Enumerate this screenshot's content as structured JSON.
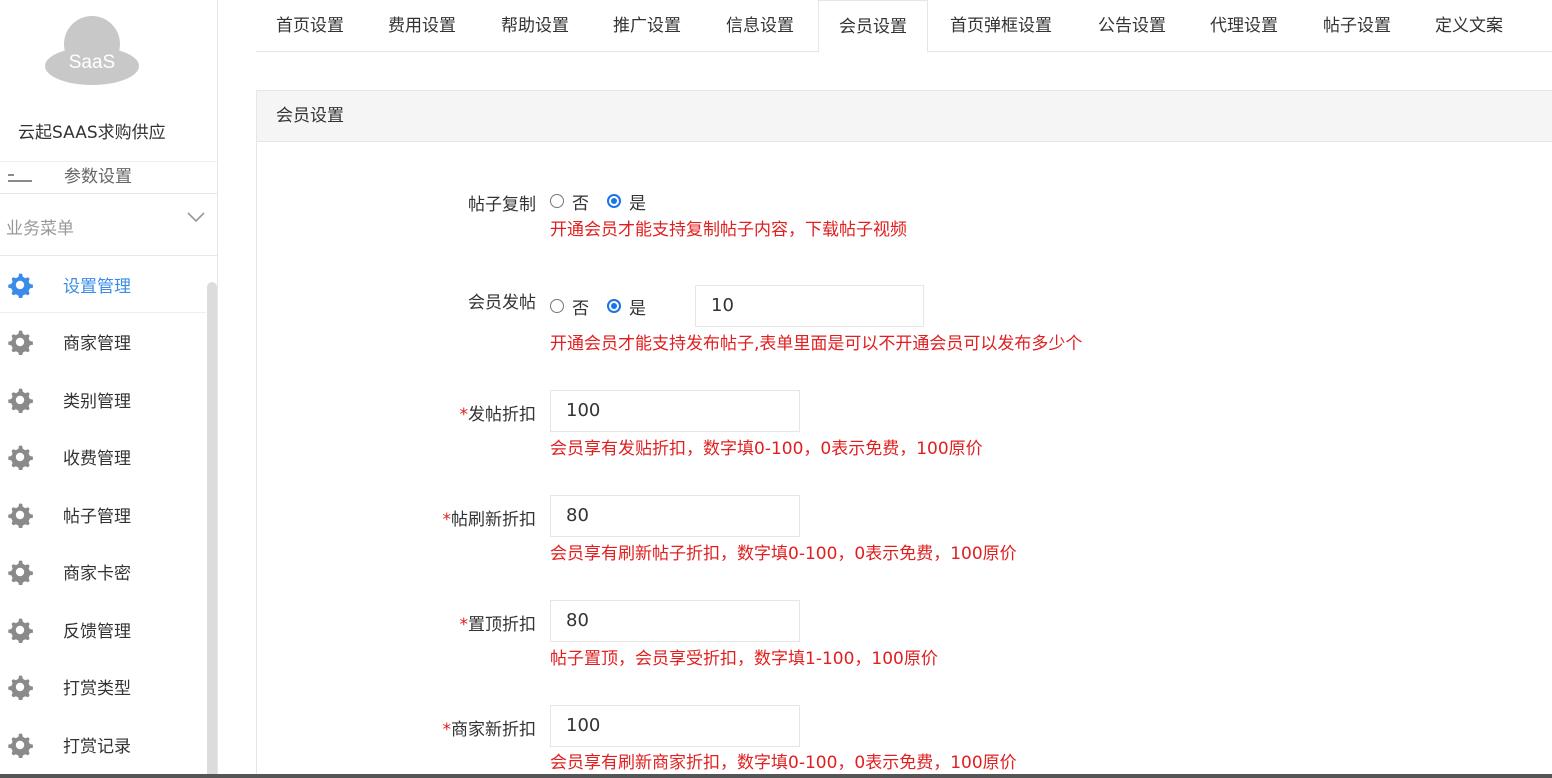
{
  "brand": {
    "logo_text": "SaaS",
    "name": "云起SAAS求购供应"
  },
  "sidebar": {
    "partial_item": "参数设置",
    "group_title": "业务菜单",
    "items": [
      {
        "label": "设置管理",
        "active": true
      },
      {
        "label": "商家管理"
      },
      {
        "label": "类别管理"
      },
      {
        "label": "收费管理"
      },
      {
        "label": "帖子管理"
      },
      {
        "label": "商家卡密"
      },
      {
        "label": "反馈管理"
      },
      {
        "label": "打赏类型"
      },
      {
        "label": "打赏记录"
      }
    ]
  },
  "tabs": [
    {
      "label": "首页设置"
    },
    {
      "label": "费用设置"
    },
    {
      "label": "帮助设置"
    },
    {
      "label": "推广设置"
    },
    {
      "label": "信息设置"
    },
    {
      "label": "会员设置",
      "active": true
    },
    {
      "label": "首页弹框设置"
    },
    {
      "label": "公告设置"
    },
    {
      "label": "代理设置"
    },
    {
      "label": "帖子设置"
    },
    {
      "label": "定义文案"
    }
  ],
  "panel": {
    "title": "会员设置"
  },
  "form": {
    "post_copy": {
      "label": "帖子复制",
      "options": [
        "否",
        "是"
      ],
      "selected": "是",
      "hint": "开通会员才能支持复制帖子内容，下载帖子视频"
    },
    "member_post": {
      "label": "会员发帖",
      "options": [
        "否",
        "是"
      ],
      "selected": "是",
      "value": "10",
      "hint": "开通会员才能支持发布帖子,表单里面是可以不开通会员可以发布多少个"
    },
    "post_discount": {
      "required": "*",
      "label": "发帖折扣",
      "value": "100",
      "hint": "会员享有发贴折扣，数字填0-100，0表示免费，100原价"
    },
    "refresh_discount": {
      "required": "*",
      "label": "帖刷新折扣",
      "value": "80",
      "hint": "会员享有刷新帖子折扣，数字填0-100，0表示免费，100原价"
    },
    "top_discount": {
      "required": "*",
      "label": "置顶折扣",
      "value": "80",
      "hint": "帖子置顶，会员享受折扣，数字填1-100，100原价"
    },
    "merchant_refresh_discount": {
      "required": "*",
      "label": "商家新折扣",
      "value": "100",
      "hint": "会员享有刷新商家折扣，数字填0-100，0表示免费，100原价"
    }
  },
  "colors": {
    "accent": "#3b8ce8",
    "hint": "#e02020",
    "radio": "#1a73e8"
  }
}
